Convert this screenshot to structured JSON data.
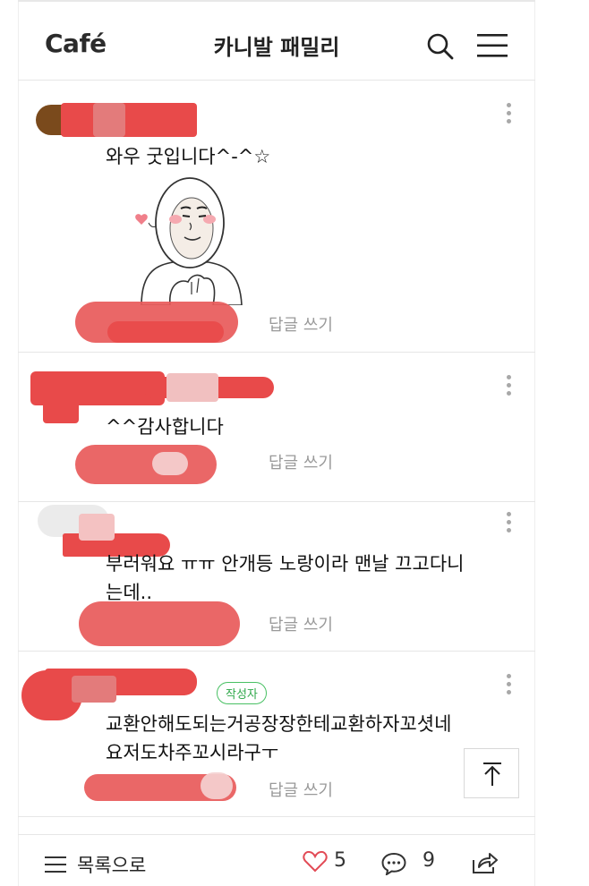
{
  "header": {
    "logo": "Café",
    "title": "카니발 패밀리"
  },
  "comments": [
    {
      "text": "와우 굿입니다^-^☆",
      "reply_label": "답글 쓰기",
      "sticker": "heart-hands-sticker"
    },
    {
      "text": "^^감사합니다",
      "reply_label": "답글 쓰기"
    },
    {
      "text_line1": "부러워요 ㅠㅠ 안개등 노랑이라 맨날 끄고다니",
      "text_line2": "는데..",
      "reply_label": "답글 쓰기"
    },
    {
      "badge": "작성자",
      "text_line1": "교환안해도되는거공장장한테교환하자꼬셧네",
      "text_line2": "요저도차주꼬시라구ㅜ",
      "reply_label": "답글 쓰기"
    }
  ],
  "bottom": {
    "list_label": "목록으로",
    "likes": "5",
    "comments": "9"
  },
  "colors": {
    "redaction": "#e84a4a",
    "badge_green": "#2fa84a",
    "accent": "#1ec800"
  }
}
